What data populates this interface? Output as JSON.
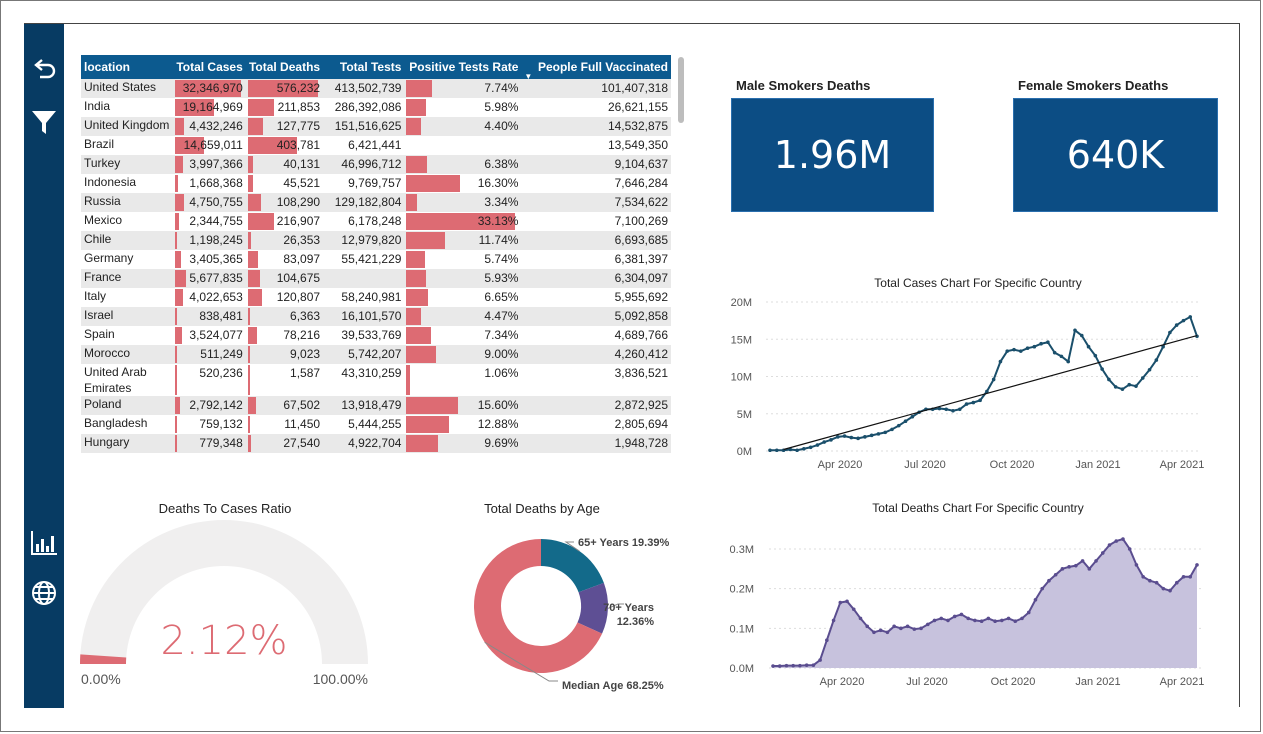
{
  "colors": {
    "navy": "#073b63",
    "header_blue": "#0c5a8f",
    "kpi_blue": "#0c4d84",
    "bar_red": "#dd6b73",
    "line_teal": "#1a4f6b",
    "area_purple": "#5a4d8f",
    "donut_teal": "#136a8a",
    "donut_purple": "#5e4f94",
    "donut_red": "#dd6b73"
  },
  "sidebar": {
    "icons": [
      "back-arrow-icon",
      "filter-icon",
      "bar-chart-icon",
      "globe-icon"
    ]
  },
  "table": {
    "headers": [
      "location",
      "Total Cases",
      "Total Deaths",
      "Total Tests",
      "Positive Tests Rate",
      "People Full Vaccinated"
    ],
    "rows": [
      {
        "location": "United States",
        "cases": "32,346,970",
        "deaths": "576,232",
        "tests": "413,502,739",
        "rate": "7.74%",
        "vacc": "101,407,318",
        "cases_v": 32346970,
        "deaths_v": 576232,
        "rate_v": 7.74
      },
      {
        "location": "India",
        "cases": "19,164,969",
        "deaths": "211,853",
        "tests": "286,392,086",
        "rate": "5.98%",
        "vacc": "26,621,155",
        "cases_v": 19164969,
        "deaths_v": 211853,
        "rate_v": 5.98
      },
      {
        "location": "United Kingdom",
        "cases": "4,432,246",
        "deaths": "127,775",
        "tests": "151,516,625",
        "rate": "4.40%",
        "vacc": "14,532,875",
        "cases_v": 4432246,
        "deaths_v": 127775,
        "rate_v": 4.4
      },
      {
        "location": "Brazil",
        "cases": "14,659,011",
        "deaths": "403,781",
        "tests": "6,421,441",
        "rate": "",
        "vacc": "13,549,350",
        "cases_v": 14659011,
        "deaths_v": 403781,
        "rate_v": 0
      },
      {
        "location": "Turkey",
        "cases": "3,997,366",
        "deaths": "40,131",
        "tests": "46,996,712",
        "rate": "6.38%",
        "vacc": "9,104,637",
        "cases_v": 3997366,
        "deaths_v": 40131,
        "rate_v": 6.38
      },
      {
        "location": "Indonesia",
        "cases": "1,668,368",
        "deaths": "45,521",
        "tests": "9,769,757",
        "rate": "16.30%",
        "vacc": "7,646,284",
        "cases_v": 1668368,
        "deaths_v": 45521,
        "rate_v": 16.3
      },
      {
        "location": "Russia",
        "cases": "4,750,755",
        "deaths": "108,290",
        "tests": "129,182,804",
        "rate": "3.34%",
        "vacc": "7,534,622",
        "cases_v": 4750755,
        "deaths_v": 108290,
        "rate_v": 3.34
      },
      {
        "location": "Mexico",
        "cases": "2,344,755",
        "deaths": "216,907",
        "tests": "6,178,248",
        "rate": "33.13%",
        "vacc": "7,100,269",
        "cases_v": 2344755,
        "deaths_v": 216907,
        "rate_v": 33.13
      },
      {
        "location": "Chile",
        "cases": "1,198,245",
        "deaths": "26,353",
        "tests": "12,979,820",
        "rate": "11.74%",
        "vacc": "6,693,685",
        "cases_v": 1198245,
        "deaths_v": 26353,
        "rate_v": 11.74
      },
      {
        "location": "Germany",
        "cases": "3,405,365",
        "deaths": "83,097",
        "tests": "55,421,229",
        "rate": "5.74%",
        "vacc": "6,381,397",
        "cases_v": 3405365,
        "deaths_v": 83097,
        "rate_v": 5.74
      },
      {
        "location": "France",
        "cases": "5,677,835",
        "deaths": "104,675",
        "tests": "",
        "rate": "5.93%",
        "vacc": "6,304,097",
        "cases_v": 5677835,
        "deaths_v": 104675,
        "rate_v": 5.93
      },
      {
        "location": "Italy",
        "cases": "4,022,653",
        "deaths": "120,807",
        "tests": "58,240,981",
        "rate": "6.65%",
        "vacc": "5,955,692",
        "cases_v": 4022653,
        "deaths_v": 120807,
        "rate_v": 6.65
      },
      {
        "location": "Israel",
        "cases": "838,481",
        "deaths": "6,363",
        "tests": "16,101,570",
        "rate": "4.47%",
        "vacc": "5,092,858",
        "cases_v": 838481,
        "deaths_v": 6363,
        "rate_v": 4.47
      },
      {
        "location": "Spain",
        "cases": "3,524,077",
        "deaths": "78,216",
        "tests": "39,533,769",
        "rate": "7.34%",
        "vacc": "4,689,766",
        "cases_v": 3524077,
        "deaths_v": 78216,
        "rate_v": 7.34
      },
      {
        "location": "Morocco",
        "cases": "511,249",
        "deaths": "9,023",
        "tests": "5,742,207",
        "rate": "9.00%",
        "vacc": "4,260,412",
        "cases_v": 511249,
        "deaths_v": 9023,
        "rate_v": 9.0
      },
      {
        "location": "United Arab Emirates",
        "cases": "520,236",
        "deaths": "1,587",
        "tests": "43,310,259",
        "rate": "1.06%",
        "vacc": "3,836,521",
        "cases_v": 520236,
        "deaths_v": 1587,
        "rate_v": 1.06
      },
      {
        "location": "Poland",
        "cases": "2,792,142",
        "deaths": "67,502",
        "tests": "13,918,479",
        "rate": "15.60%",
        "vacc": "2,872,925",
        "cases_v": 2792142,
        "deaths_v": 67502,
        "rate_v": 15.6
      },
      {
        "location": "Bangladesh",
        "cases": "759,132",
        "deaths": "11,450",
        "tests": "5,444,255",
        "rate": "12.88%",
        "vacc": "2,805,694",
        "cases_v": 759132,
        "deaths_v": 11450,
        "rate_v": 12.88
      },
      {
        "location": "Hungary",
        "cases": "779,348",
        "deaths": "27,540",
        "tests": "4,922,704",
        "rate": "9.69%",
        "vacc": "1,948,728",
        "cases_v": 779348,
        "deaths_v": 27540,
        "rate_v": 9.69
      }
    ]
  },
  "kpis": {
    "male_title": "Male Smokers Deaths",
    "male_value": "1.96M",
    "female_title": "Female Smokers Deaths",
    "female_value": "640K"
  },
  "gauge": {
    "title": "Deaths To Cases Ratio",
    "value_label": "2.12%",
    "value": 2.12,
    "min_label": "0.00%",
    "max_label": "100.00%"
  },
  "donut": {
    "title": "Total Deaths by Age",
    "slices": [
      {
        "label": "65+ Years 19.39%",
        "value": 19.39,
        "color": "#136a8a"
      },
      {
        "label": "70+ Years 12.36%",
        "value": 12.36,
        "color": "#5e4f94"
      },
      {
        "label": "Median Age 68.25%",
        "value": 68.25,
        "color": "#dd6b73"
      }
    ]
  },
  "chart_data": [
    {
      "type": "line",
      "title": "Total Cases Chart For Specific Country",
      "x_ticks": [
        "Apr 2020",
        "Jul 2020",
        "Oct 2020",
        "Jan 2021",
        "Apr 2021"
      ],
      "y_ticks": [
        "0M",
        "5M",
        "10M",
        "15M",
        "20M"
      ],
      "ylim": [
        0,
        20
      ],
      "x": [
        0,
        1,
        2,
        3,
        4,
        5,
        6,
        7,
        8,
        9,
        10,
        11,
        12,
        13,
        14,
        15,
        16,
        17,
        18,
        19,
        20,
        21,
        22,
        23,
        24,
        25,
        26,
        27,
        28,
        29,
        30,
        31,
        32,
        33,
        34,
        35,
        36,
        37,
        38,
        39,
        40,
        41,
        42,
        43,
        44,
        45,
        46,
        47,
        48,
        49,
        50,
        51,
        52,
        53,
        54,
        55,
        56,
        57,
        58,
        59,
        60,
        61,
        62,
        63
      ],
      "series": [
        {
          "name": "",
          "values": [
            0.1,
            0.1,
            0.1,
            0.2,
            0.1,
            0.3,
            0.5,
            0.8,
            1.2,
            1.5,
            1.9,
            2.0,
            1.8,
            1.7,
            1.9,
            2.1,
            2.3,
            2.5,
            2.9,
            3.4,
            4.0,
            4.6,
            5.2,
            5.6,
            5.6,
            5.7,
            5.6,
            5.4,
            5.6,
            6.3,
            6.5,
            6.8,
            8.0,
            9.6,
            12.0,
            13.4,
            13.6,
            13.4,
            13.8,
            14.0,
            14.4,
            14.6,
            13.2,
            12.7,
            12.0,
            16.2,
            15.5,
            14.0,
            12.8,
            11.0,
            9.6,
            8.6,
            8.3,
            8.9,
            8.7,
            9.8,
            10.9,
            12.2,
            14.0,
            15.9,
            16.9,
            17.5,
            18.0,
            15.4
          ]
        },
        {
          "name": "",
          "values": [
            -0.5,
            0.0,
            0.2,
            0.5,
            0.7,
            1.0,
            1.2,
            1.5,
            1.7,
            2.0,
            2.2,
            2.5,
            2.7,
            3.0,
            3.2,
            3.5,
            3.7,
            4.0,
            4.2,
            4.5,
            4.7,
            5.0,
            5.2,
            5.5,
            5.7,
            6.0,
            6.2,
            6.5,
            6.7,
            7.0,
            7.2,
            7.5,
            7.7,
            8.0,
            8.2,
            8.5,
            8.7,
            9.0,
            9.2,
            9.5,
            9.7,
            10.0,
            10.2,
            10.5,
            10.7,
            11.0,
            11.2,
            11.5,
            11.7,
            12.0,
            12.2,
            12.5,
            12.7,
            13.0,
            13.2,
            13.5,
            13.7,
            14.0,
            14.2,
            14.5,
            14.7,
            15.0,
            15.2,
            15.5
          ]
        }
      ]
    },
    {
      "type": "area",
      "title": "Total Deaths Chart For Specific Country",
      "x_ticks": [
        "Apr 2020",
        "Jul 2020",
        "Oct 2020",
        "Jan 2021",
        "Apr 2021"
      ],
      "y_ticks": [
        "0.0M",
        "0.1M",
        "0.2M",
        "0.3M"
      ],
      "ylim": [
        0,
        0.3
      ],
      "x": [
        0,
        1,
        2,
        3,
        4,
        5,
        6,
        7,
        8,
        9,
        10,
        11,
        12,
        13,
        14,
        15,
        16,
        17,
        18,
        19,
        20,
        21,
        22,
        23,
        24,
        25,
        26,
        27,
        28,
        29,
        30,
        31,
        32,
        33,
        34,
        35,
        36,
        37,
        38,
        39,
        40,
        41,
        42,
        43,
        44,
        45,
        46,
        47,
        48,
        49,
        50,
        51,
        52,
        53,
        54,
        55,
        56,
        57,
        58,
        59,
        60,
        61,
        62,
        63
      ],
      "series": [
        {
          "name": "",
          "values": [
            0.005,
            0.005,
            0.006,
            0.006,
            0.006,
            0.007,
            0.007,
            0.02,
            0.07,
            0.12,
            0.165,
            0.168,
            0.148,
            0.125,
            0.105,
            0.09,
            0.095,
            0.09,
            0.105,
            0.1,
            0.105,
            0.098,
            0.1,
            0.11,
            0.12,
            0.125,
            0.12,
            0.13,
            0.135,
            0.125,
            0.12,
            0.118,
            0.125,
            0.118,
            0.12,
            0.125,
            0.118,
            0.125,
            0.14,
            0.172,
            0.2,
            0.22,
            0.235,
            0.25,
            0.255,
            0.258,
            0.27,
            0.25,
            0.27,
            0.29,
            0.31,
            0.32,
            0.325,
            0.3,
            0.26,
            0.23,
            0.22,
            0.215,
            0.2,
            0.195,
            0.215,
            0.23,
            0.23,
            0.26
          ]
        }
      ]
    }
  ]
}
